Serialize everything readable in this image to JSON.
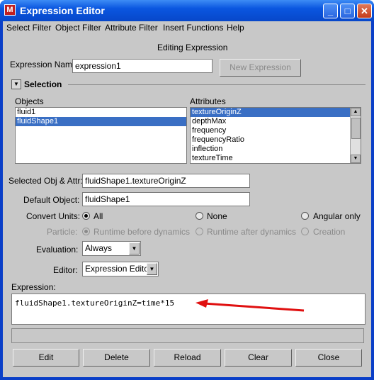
{
  "window": {
    "title": "Expression Editor",
    "minimize_glyph": "_",
    "maximize_glyph": "□",
    "close_glyph": "✕"
  },
  "menu": [
    "Select Filter",
    "Object Filter",
    "Attribute Filter",
    "Insert Functions",
    "Help"
  ],
  "header": "Editing Expression",
  "expression_name": {
    "label": "Expression Name",
    "value": "expression1",
    "new_button": "New Expression"
  },
  "selection": {
    "title": "Selection",
    "objects_label": "Objects",
    "attributes_label": "Attributes",
    "objects": [
      {
        "text": "fluid1",
        "selected": false
      },
      {
        "text": "fluidShape1",
        "selected": true
      }
    ],
    "attributes": [
      {
        "text": "textureOriginZ",
        "selected": true
      },
      {
        "text": "depthMax",
        "selected": false
      },
      {
        "text": "frequency",
        "selected": false
      },
      {
        "text": "frequencyRatio",
        "selected": false
      },
      {
        "text": "inflection",
        "selected": false
      },
      {
        "text": "textureTime",
        "selected": false
      }
    ]
  },
  "selected_obj_attr": {
    "label": "Selected Obj & Attr:",
    "value": "fluidShape1.textureOriginZ"
  },
  "default_object": {
    "label": "Default Object:",
    "value": "fluidShape1"
  },
  "convert_units": {
    "label": "Convert Units:",
    "options": [
      "All",
      "None",
      "Angular only"
    ],
    "selected": "All"
  },
  "particle": {
    "label": "Particle:",
    "options": [
      "Runtime before dynamics",
      "Runtime after dynamics",
      "Creation"
    ],
    "selected": "Runtime before dynamics"
  },
  "evaluation": {
    "label": "Evaluation:",
    "value": "Always"
  },
  "editor": {
    "label": "Editor:",
    "value": "Expression Editor"
  },
  "expression": {
    "label": "Expression:",
    "text": "fluidShape1.textureOriginZ=time*15"
  },
  "buttons": {
    "edit": "Edit",
    "delete": "Delete",
    "reload": "Reload",
    "clear": "Clear",
    "close": "Close"
  },
  "colors": {
    "selection": "#3a6fc4",
    "arrow": "#e01010",
    "title_bar": "#0a56e0"
  }
}
